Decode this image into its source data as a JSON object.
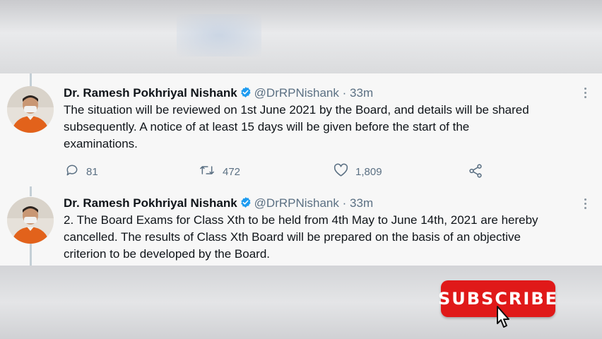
{
  "tweets": [
    {
      "author": "Dr. Ramesh Pokhriyal Nishank",
      "handle": "@DrRPNishank",
      "separator": "·",
      "time": "33m",
      "text": "The situation will be reviewed on 1st June 2021 by the Board, and details will be shared\nsubsequently. A notice of at least 15 days will be given before the start of the\nexaminations.",
      "replies": "81",
      "retweets": "472",
      "likes": "1,809"
    },
    {
      "author": "Dr. Ramesh Pokhriyal Nishank",
      "handle": "@DrRPNishank",
      "separator": "·",
      "time": "33m",
      "text": "2.  The Board Exams for Class Xth to be held from 4th May  to June 14th, 2021 are hereby\ncancelled. The results of Class Xth Board will be prepared on the basis of an objective\ncriterion to be developed by the Board."
    }
  ],
  "subscribe": {
    "label": "SUBSCRIBE",
    "color": "#e01919"
  },
  "icons": {
    "verified": "verified-badge-icon",
    "reply": "reply-icon",
    "retweet": "retweet-icon",
    "like": "heart-icon",
    "share": "share-icon",
    "more": "more-vertical-icon",
    "cursor": "hand-pointer-icon"
  },
  "colors": {
    "verified": "#1d9bf0",
    "muted": "#5b7083",
    "text": "#0f1419"
  }
}
